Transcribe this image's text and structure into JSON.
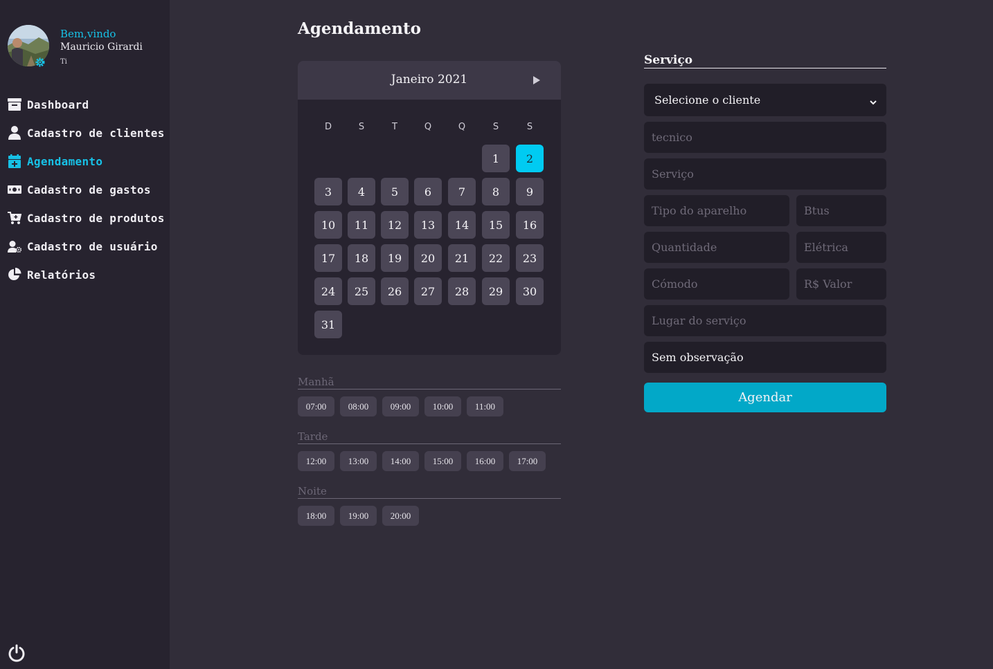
{
  "sidebar": {
    "welcome": "Bem,vindo",
    "user_name": "Mauricio Girardi",
    "user_role": "Ti",
    "items": [
      {
        "label": "Dashboard",
        "icon": "dashboard-icon"
      },
      {
        "label": "Cadastro de clientes",
        "icon": "user-icon"
      },
      {
        "label": "Agendamento",
        "icon": "calendar-plus-icon",
        "active": true
      },
      {
        "label": "Cadastro de gastos",
        "icon": "money-bill-icon"
      },
      {
        "label": "Cadastro de produtos",
        "icon": "cart-plus-icon"
      },
      {
        "label": "Cadastro de usuário",
        "icon": "user-gear-icon"
      },
      {
        "label": "Relatórios",
        "icon": "pie-chart-icon"
      }
    ],
    "logout_icon": "power-icon"
  },
  "main": {
    "title": "Agendamento",
    "calendar": {
      "month_label": "Janeiro 2021",
      "next_icon": "play-icon",
      "weekdays": [
        "D",
        "S",
        "T",
        "Q",
        "Q",
        "S",
        "S"
      ],
      "days": [
        "1",
        "2",
        "3",
        "4",
        "5",
        "6",
        "7",
        "8",
        "9",
        "10",
        "11",
        "12",
        "13",
        "14",
        "15",
        "16",
        "17",
        "18",
        "19",
        "20",
        "21",
        "22",
        "23",
        "24",
        "25",
        "26",
        "27",
        "28",
        "29",
        "30",
        "31"
      ],
      "selected_day": "2"
    },
    "periods": [
      {
        "label": "Manhã",
        "slots": [
          "07:00",
          "08:00",
          "09:00",
          "10:00",
          "11:00"
        ]
      },
      {
        "label": "Tarde",
        "slots": [
          "12:00",
          "13:00",
          "14:00",
          "15:00",
          "16:00",
          "17:00"
        ]
      },
      {
        "label": "Noite",
        "slots": [
          "18:00",
          "19:00",
          "20:00"
        ]
      }
    ]
  },
  "form": {
    "title": "Serviço",
    "client_select": "Selecione o cliente",
    "fields": {
      "tecnico": "tecnico",
      "servico": "Serviço",
      "tipo_aparelho": "Tipo do aparelho",
      "btus": "Btus",
      "quantidade": "Quantidade",
      "eletrica": "Elétrica",
      "comodo": "Cómodo",
      "valor": "R$ Valor",
      "lugar": "Lugar do serviço",
      "observacao": "Sem observação"
    },
    "submit": "Agendar"
  },
  "colors": {
    "accent": "#17c1e6",
    "selected_day": "#00cbf2",
    "button": "#02a8c8",
    "sidebar_bg": "#27232f",
    "page_bg": "#312d39"
  }
}
